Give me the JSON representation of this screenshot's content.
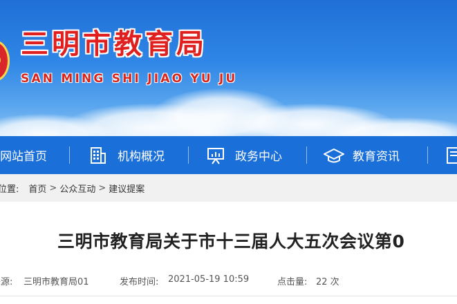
{
  "site": {
    "title": "三明市教育局",
    "pinyin": "SAN MING SHI JIAO YU JU"
  },
  "nav": {
    "items": [
      {
        "label": "网站首页",
        "icon": "home-icon"
      },
      {
        "label": "机构概况",
        "icon": "building-icon"
      },
      {
        "label": "政务中心",
        "icon": "presentation-icon"
      },
      {
        "label": "教育资讯",
        "icon": "graduation-cap-icon"
      },
      {
        "label": "",
        "icon": "document-icon"
      }
    ]
  },
  "breadcrumb": {
    "label": "前位置:",
    "items": [
      "首页",
      "公众互动",
      "建议提案"
    ],
    "separator": ">"
  },
  "article": {
    "title": "三明市教育局关于市十三届人大五次会议第0",
    "source_label": "来源:",
    "source": "三明市教育局01",
    "published_label": "发布时间:",
    "published": "2021-05-19 10:59",
    "views_label": "点击量:",
    "views": "22 次"
  },
  "colors": {
    "nav_bg": "#1a6fd8",
    "title_red": "#e0201e",
    "breadcrumb_bg": "#f1f1f1"
  }
}
